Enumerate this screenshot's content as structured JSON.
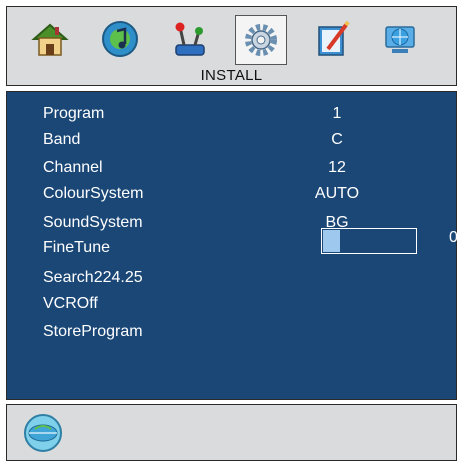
{
  "header": {
    "active_tab_label": "INSTALL",
    "tabs": [
      {
        "icon": "house-icon"
      },
      {
        "icon": "music-icon"
      },
      {
        "icon": "joystick-icon"
      },
      {
        "icon": "gear-icon",
        "active": true
      },
      {
        "icon": "notepad-icon"
      },
      {
        "icon": "globe-icon"
      }
    ]
  },
  "menu": {
    "items": [
      {
        "label": "Program",
        "value": "1"
      },
      {
        "label": "Band",
        "value": "C"
      },
      {
        "label": "Channel",
        "value": "12"
      },
      {
        "label": "ColourSystem",
        "value": "AUTO"
      },
      {
        "label": "SoundSystem",
        "value": "BG"
      },
      {
        "label": "FineTune",
        "value": "0",
        "slider_fraction": 0.18
      },
      {
        "label": "Search224.25"
      },
      {
        "label": "VCROff"
      },
      {
        "label": "StoreProgram"
      }
    ]
  },
  "footer": {
    "icon": "globe-icon"
  },
  "colors": {
    "panel_bg": "#1b4777",
    "bar_bg": "#d9dbdc",
    "slider_fill": "#9fc8ef",
    "text": "#ffffff"
  }
}
